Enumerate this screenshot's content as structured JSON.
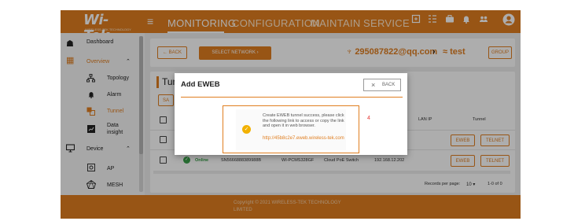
{
  "brand": {
    "logo": "Wi-Tek",
    "tagline": "WIRELESS-TEK TECHNOLOGY"
  },
  "nav": [
    "MONITORING",
    "CONFIGURATION",
    "MAINTAIN",
    "SERVICE"
  ],
  "sidebar": {
    "dashboard": "Dashboard",
    "overview": "Overview",
    "topology": "Topology",
    "alarm": "Alarm",
    "tunnel": "Tunnel",
    "data_insight_1": "Data",
    "data_insight_2": "insight",
    "device": "Device",
    "ap": "AP",
    "mesh": "MESH"
  },
  "toolbar": {
    "back": "BACK",
    "select_network": "SELECT NETWORK",
    "account": "295087822@qq.com",
    "network": "test",
    "group": "GROUP"
  },
  "page": {
    "title": "Tunnel"
  },
  "table": {
    "headers": {
      "lan_ip": "LAN IP",
      "tunnel": "Tunnel"
    },
    "row": {
      "status": "Online",
      "sn": "SN5666888389988B",
      "model": "WI-PCMS328GF",
      "type": "Cloud PoE Switch",
      "ip": "192.168.12.202",
      "eweb": "EWEB",
      "telnet": "TELNET"
    },
    "pagination": {
      "label": "Records per page:",
      "per_page": "10",
      "range": "1-0 of 0"
    }
  },
  "footer": {
    "line1": "Copyright © 2021 WIRELESS-TEK TECHNOLOGY",
    "line2": "LIMITED"
  },
  "modal": {
    "title": "Add EWEB",
    "back": "BACK",
    "message": "Create EWEB tunnel success, please click the following link to access or copy the link and open it in web browser.",
    "link": "http://45b8c2e7.eweb.wireless-tek.com",
    "marker": "4"
  },
  "colors": {
    "accent": "#e07e20",
    "online": "#3aa14a",
    "warning": "#f2b100",
    "marker": "#e53935"
  }
}
